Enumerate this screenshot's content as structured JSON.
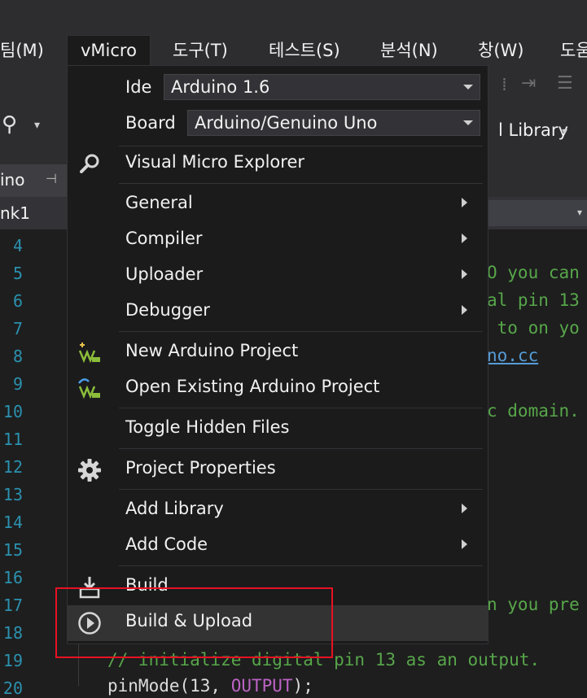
{
  "menubar": {
    "items": [
      "팀(M)",
      "vMicro",
      "도구(T)",
      "테스트(S)",
      "분석(N)",
      "창(W)",
      "도움"
    ]
  },
  "toolbar": {
    "library_label": "l Library"
  },
  "tabs": {
    "doc_tab": "ino",
    "nav_left": "nk1"
  },
  "editor": {
    "line_numbers": [
      "4",
      "5",
      "6",
      "7",
      "8",
      "9",
      "10",
      "11",
      "12",
      "13",
      "14",
      "15",
      "16",
      "17",
      "18",
      "19",
      "20"
    ],
    "frag_5": "O you can",
    "frag_6": "al pin 13",
    "frag_7": " to on yo",
    "frag_8": "no.cc",
    "frag_10": "c domain.",
    "frag_17": "n you pre",
    "line_19": "// initialize digital pin 13 as an output.",
    "line_20_plain": "pinMode(13, ",
    "line_20_kw": "OUTPUT",
    "line_20_end": ");"
  },
  "menu": {
    "ide_label": "Ide",
    "ide_value": "Arduino 1.6",
    "board_label": "Board",
    "board_value": "Arduino/Genuino Uno",
    "items": [
      {
        "label": "Visual Micro Explorer",
        "icon": "search-icon"
      },
      {
        "label": "General",
        "submenu": true
      },
      {
        "label": "Compiler",
        "submenu": true
      },
      {
        "label": "Uploader",
        "submenu": true
      },
      {
        "label": "Debugger",
        "submenu": true
      },
      {
        "label": "New Arduino Project",
        "icon": "new-project-icon"
      },
      {
        "label": "Open Existing Arduino Project",
        "icon": "open-project-icon"
      },
      {
        "label": "Toggle Hidden Files"
      },
      {
        "label": "Project Properties",
        "icon": "gear-icon"
      },
      {
        "label": "Add Library",
        "submenu": true
      },
      {
        "label": "Add Code",
        "submenu": true
      },
      {
        "label": "Build",
        "icon": "build-icon"
      },
      {
        "label": "Build & Upload",
        "icon": "play-circle-icon",
        "highlighted": true
      }
    ]
  },
  "colors": {
    "menu_bg": "#1b1b1c",
    "highlight": "#333334",
    "annotation_box": "#e81123",
    "comment": "#57a64a",
    "line_number": "#2b91af"
  }
}
